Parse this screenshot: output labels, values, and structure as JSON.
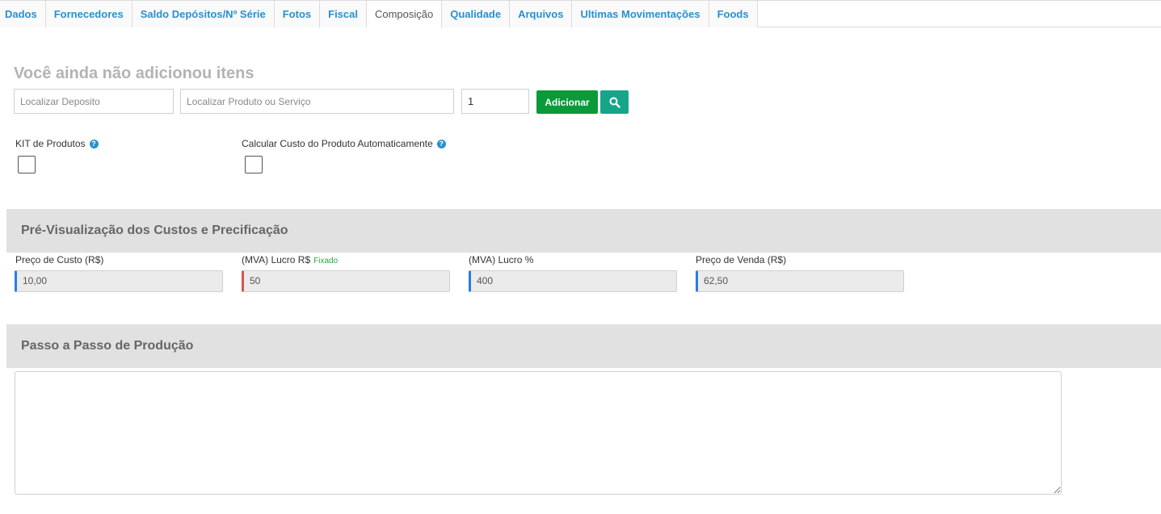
{
  "tabs": [
    {
      "label": "Dados"
    },
    {
      "label": "Fornecedores"
    },
    {
      "label": "Saldo Depósitos/Nº Série"
    },
    {
      "label": "Fotos"
    },
    {
      "label": "Fiscal"
    },
    {
      "label": "Composição",
      "active": true
    },
    {
      "label": "Qualidade"
    },
    {
      "label": "Arquivos"
    },
    {
      "label": "Ultimas Movimentações"
    },
    {
      "label": "Foods"
    }
  ],
  "composition": {
    "empty_title": "Você ainda não adicionou itens",
    "deposit_placeholder": "Localizar Deposito",
    "product_placeholder": "Localizar Produto ou Serviço",
    "quantity_value": "1",
    "add_label": "Adicionar",
    "search_icon": "search-icon"
  },
  "options": {
    "kit_label": "KIT de Produtos",
    "auto_cost_label": "Calcular Custo do Produto Automaticamente",
    "help_glyph": "?"
  },
  "pricing": {
    "title": "Pré-Visualização dos Custos e Precificação",
    "cost_label": "Preço de Custo (R$)",
    "cost_value": "10,00",
    "profit_label": "(MVA) Lucro R$",
    "profit_badge": "Fixado",
    "profit_value": "50",
    "profit_pct_label": "(MVA) Lucro %",
    "profit_pct_value": "400",
    "sale_label": "Preço de Venda (R$)",
    "sale_value": "62,50"
  },
  "production": {
    "title": "Passo a Passo de Produção"
  },
  "colors": {
    "tab_link": "#2a8fd0",
    "add_button": "#0a9a3a",
    "search_button": "#17a589",
    "section_bg": "#e1e1e1",
    "accent_blue": "#2a7de1",
    "accent_red": "#d9534f",
    "fixado_green": "#27a845"
  }
}
